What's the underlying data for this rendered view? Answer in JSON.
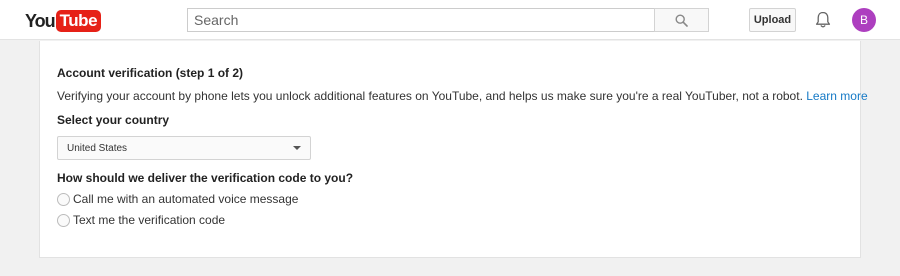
{
  "header": {
    "logo_you": "You",
    "logo_tube": "Tube",
    "search_placeholder": "Search",
    "upload_label": "Upload",
    "avatar_initial": "B",
    "brand_color": "#e62117",
    "avatar_color": "#ad3fbf"
  },
  "verification": {
    "title": "Account verification (step 1 of 2)",
    "description": "Verifying your account by phone lets you unlock additional features on YouTube, and helps us make sure you're a real YouTuber, not a robot.",
    "learn_more": "Learn more",
    "link_color": "#167ac6",
    "country_label": "Select your country",
    "country_selected": "United States",
    "delivery_question": "How should we deliver the verification code to you?",
    "options": [
      {
        "label": "Call me with an automated voice message",
        "selected": false
      },
      {
        "label": "Text me the verification code",
        "selected": false
      }
    ]
  }
}
